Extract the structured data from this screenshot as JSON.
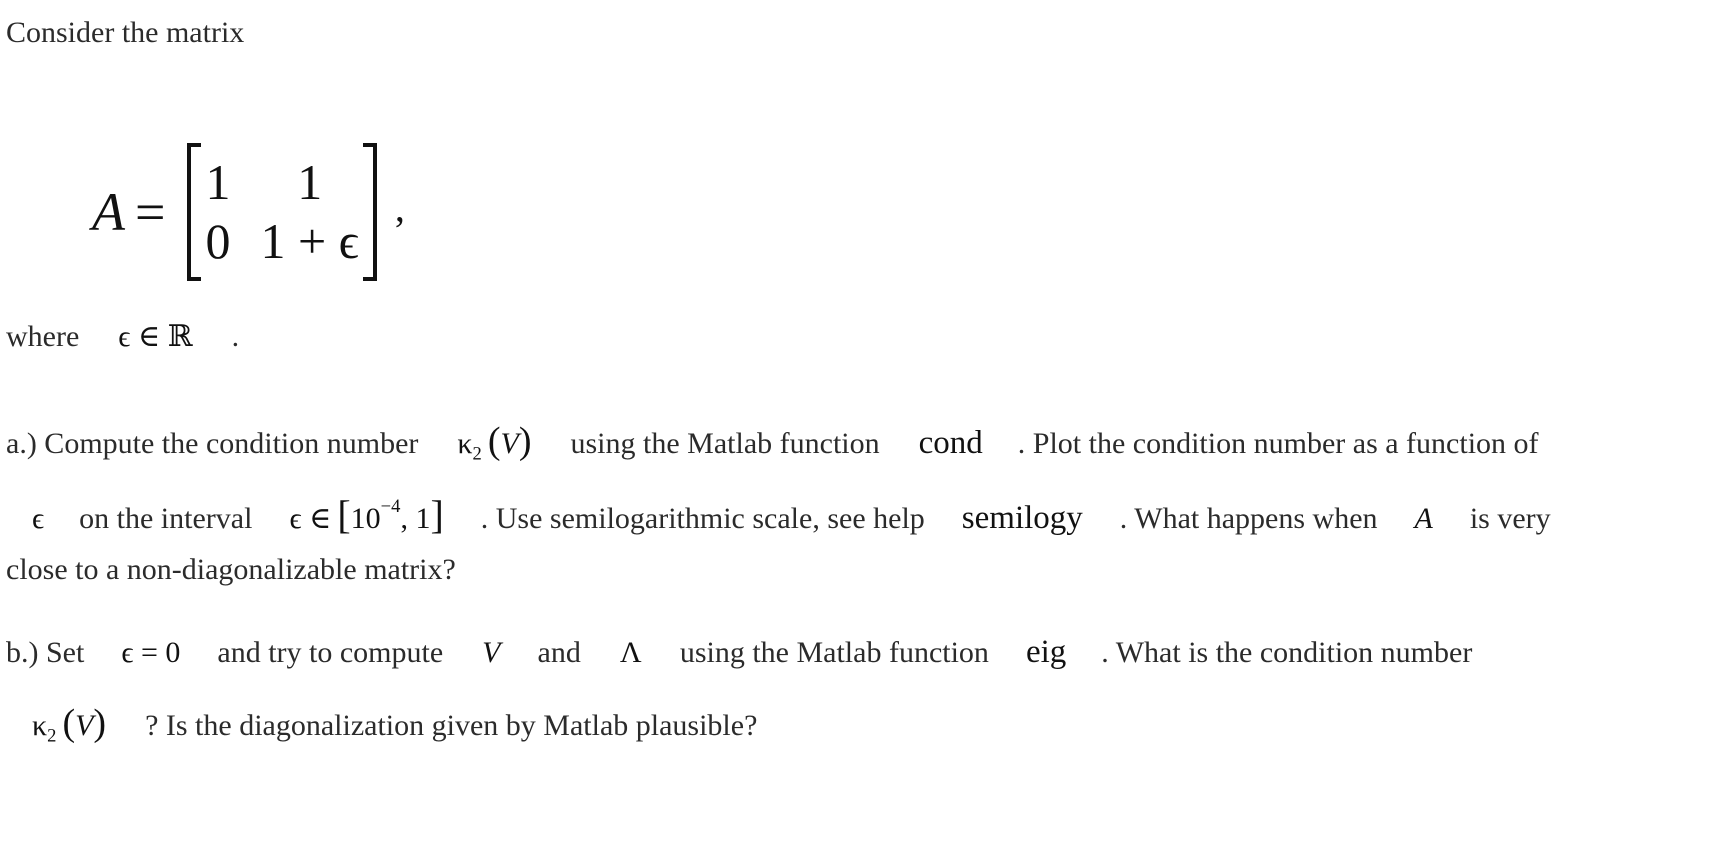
{
  "intro": {
    "text": "Consider the matrix"
  },
  "matrix": {
    "lhs": "A",
    "equals": "=",
    "rows": [
      [
        "1",
        "1"
      ],
      [
        "0",
        "1 + ϵ"
      ]
    ],
    "trailing": ","
  },
  "where_line": {
    "text": "where",
    "math": "ϵ ∈ ℝ",
    "end": "."
  },
  "part_a": {
    "line1": {
      "t1": "a.) Compute the condition number",
      "kappa": "κ",
      "kappa_sub": "2",
      "kappa_arg_open": "(",
      "kappa_arg": "V",
      "kappa_arg_close": ")",
      "t2": "using the Matlab function",
      "func": "cond",
      "t3": ". Plot the condition number as a function of"
    },
    "line2": {
      "eps": "ϵ",
      "t1": "on the interval",
      "math_prefix": "ϵ ∈",
      "interval_open": "[",
      "interval_base": "10",
      "interval_exp": "−4",
      "interval_rest": ", 1",
      "interval_close": "]",
      "t2": ". Use semilogarithmic scale, see help",
      "func": "semilogy",
      "t3": ". What happens when",
      "var": "A",
      "t4": "is very"
    },
    "line3": {
      "text": "close to a non-diagonalizable matrix?"
    }
  },
  "part_b": {
    "line1": {
      "t1": "b.) Set",
      "math": "ϵ = 0",
      "t2": "and try to compute",
      "var_v": "V",
      "t3": "and",
      "var_lambda": "Λ",
      "t4": "using the Matlab function",
      "func": "eig",
      "t5": ". What is the condition number"
    },
    "line2": {
      "kappa": "κ",
      "kappa_sub": "2",
      "kappa_arg_open": "(",
      "kappa_arg": "V",
      "kappa_arg_close": ")",
      "t1": "? Is the diagonalization given by Matlab plausible?"
    }
  }
}
